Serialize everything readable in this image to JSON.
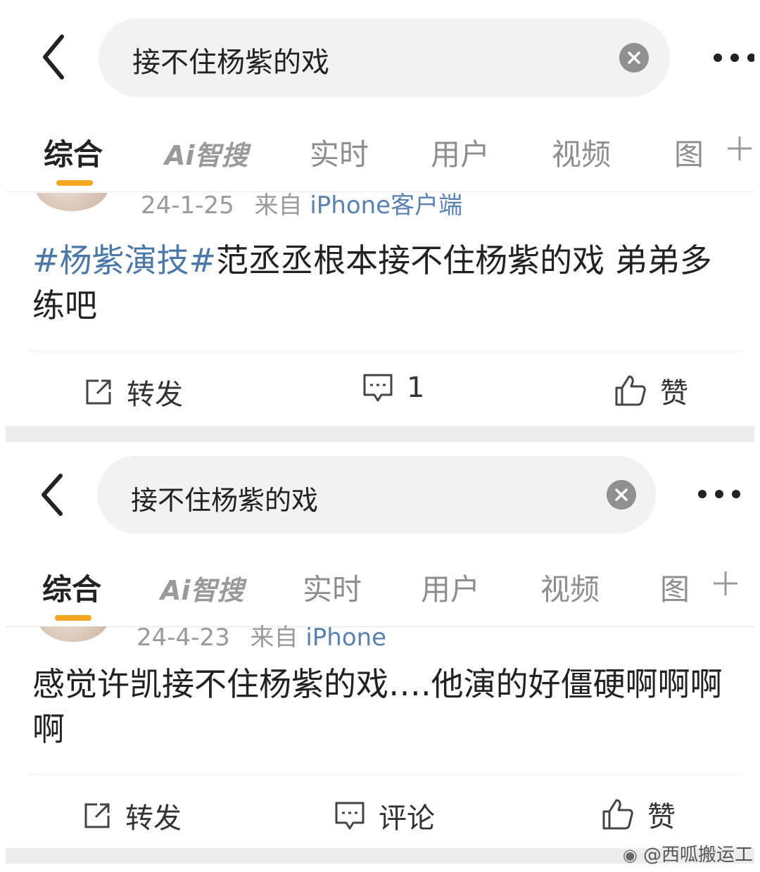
{
  "screens": [
    {
      "search": {
        "query": "接不住杨紫的戏"
      },
      "tabs": [
        "综合",
        "实时",
        "用户",
        "视频",
        "图"
      ],
      "ai_tab": "Ai智搜",
      "post": {
        "meta_date": "24-1-25",
        "meta_from": "来自",
        "meta_source": "iPhone客户端",
        "topic": "#杨紫演技#",
        "text": "范丞丞根本接不住杨紫的戏 弟弟多练吧"
      },
      "actions": {
        "repost": "转发",
        "comment": "1",
        "like": "赞"
      }
    },
    {
      "search": {
        "query": "接不住杨紫的戏"
      },
      "tabs": [
        "综合",
        "实时",
        "用户",
        "视频",
        "图"
      ],
      "ai_tab": "Ai智搜",
      "post": {
        "meta_date": "24-4-23",
        "meta_from": "来自",
        "meta_source": "iPhone",
        "text": "感觉许凯接不住杨紫的戏….他演的好僵硬啊啊啊啊"
      },
      "actions": {
        "repost": "转发",
        "comment": "评论",
        "like": "赞"
      }
    }
  ],
  "watermark": "@西呱搬运工",
  "colors": {
    "accent": "#f5a623",
    "topic": "#4c78a8",
    "source": "#5a82b0"
  }
}
